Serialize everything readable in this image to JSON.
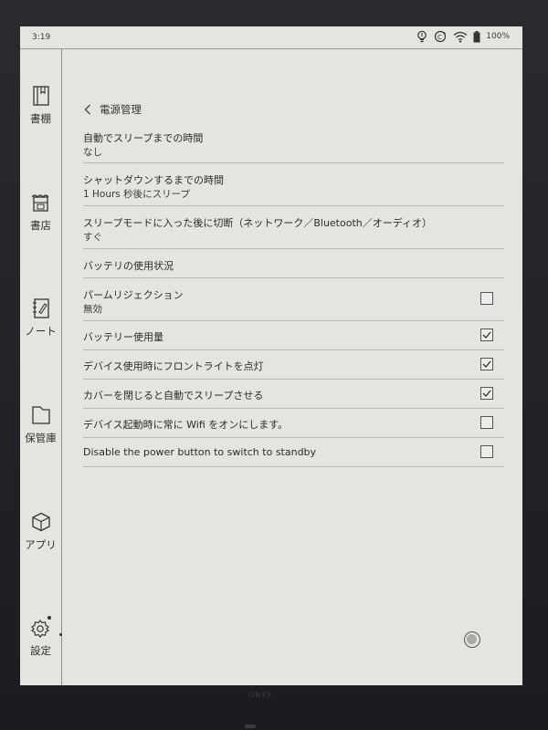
{
  "status_bar": {
    "time": "3:19",
    "battery": "100%",
    "icons": [
      "bulb-icon",
      "sync-icon",
      "wifi-icon",
      "battery-icon"
    ]
  },
  "sidebar": {
    "items": [
      {
        "label": "書棚",
        "icon": "book-icon"
      },
      {
        "label": "書店",
        "icon": "shop-icon"
      },
      {
        "label": "ノート",
        "icon": "note-icon"
      },
      {
        "label": "保管庫",
        "icon": "folder-icon"
      },
      {
        "label": "アプリ",
        "icon": "box-icon"
      },
      {
        "label": "設定",
        "icon": "gear-icon"
      }
    ]
  },
  "header": {
    "title": "電源管理"
  },
  "settings": [
    {
      "title": "自動でスリープまでの時間",
      "subtitle": "なし"
    },
    {
      "title": "シャットダウンするまでの時間",
      "subtitle": "1 Hours 秒後にスリープ"
    },
    {
      "title": "スリープモードに入った後に切断（ネットワーク／Bluetooth／オーディオ）",
      "subtitle": "すぐ"
    },
    {
      "title": "バッテリの使用状況"
    },
    {
      "title": "パームリジェクション",
      "subtitle": "無効",
      "checked": false
    },
    {
      "title": "バッテリー使用量",
      "checked": true
    },
    {
      "title": "デバイス使用時にフロントライトを点灯",
      "checked": true
    },
    {
      "title": "カバーを閉じると自動でスリープさせる",
      "checked": true
    },
    {
      "title": "デバイス起動時に常に Wifi をオンにします。",
      "checked": false
    },
    {
      "title": "Disable the power button to switch to standby",
      "checked": false
    }
  ],
  "brand": "ONYX",
  "colors": {
    "screen_bg": "#e4e4e1",
    "bezel": "#1e1f22",
    "divider": "#b9b9b6"
  }
}
